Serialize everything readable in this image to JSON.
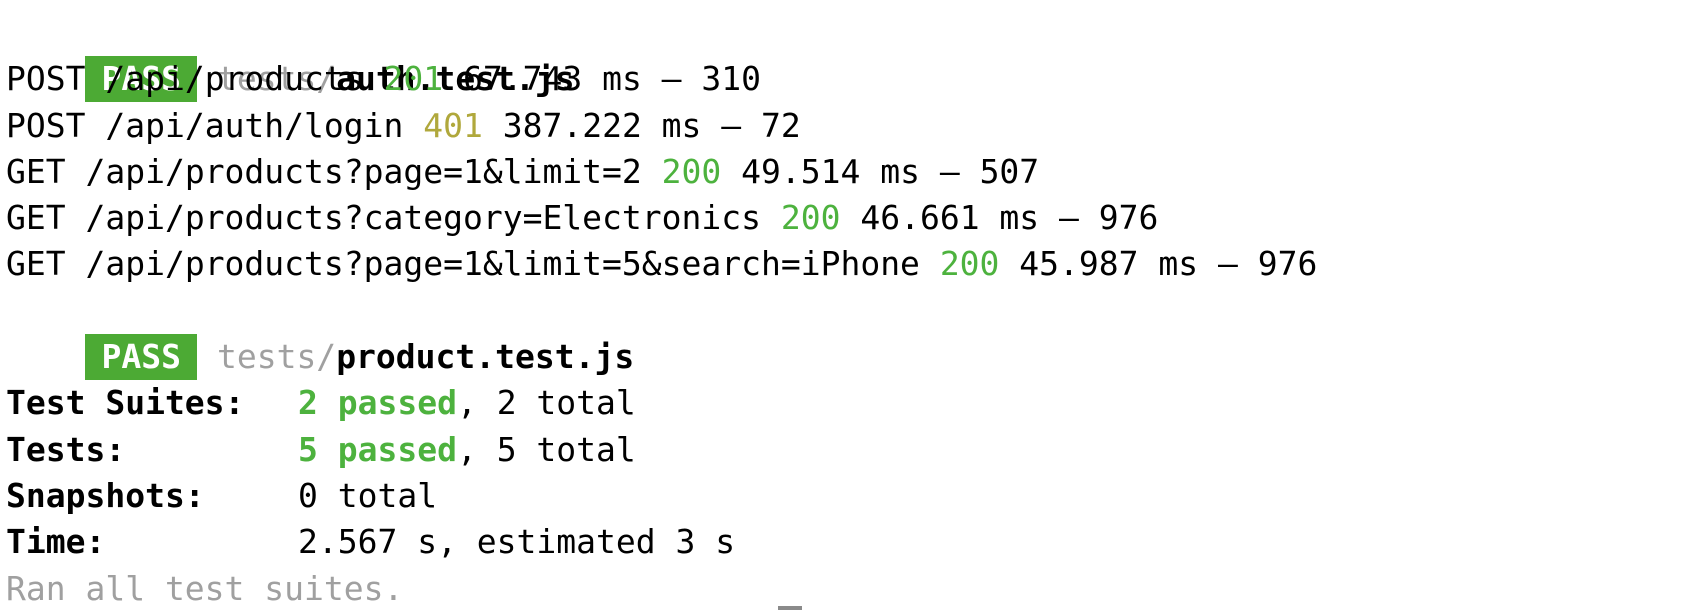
{
  "suites": [
    {
      "badge": "PASS",
      "dir": "tests/",
      "file": "auth.test.js"
    },
    {
      "badge": "PASS",
      "dir": "tests/",
      "file": "product.test.js"
    }
  ],
  "requests": [
    {
      "method": "POST",
      "path": "/api/products",
      "status": "201",
      "status_color": "#4db23e",
      "time": "67.743 ms",
      "size": "310"
    },
    {
      "method": "POST",
      "path": "/api/auth/login",
      "status": "401",
      "status_color": "#b0a83c",
      "time": "387.222 ms",
      "size": "72"
    },
    {
      "method": "GET",
      "path": "/api/products?page=1&limit=2",
      "status": "200",
      "status_color": "#4db23e",
      "time": "49.514 ms",
      "size": "507"
    },
    {
      "method": "GET",
      "path": "/api/products?category=Electronics",
      "status": "200",
      "status_color": "#4db23e",
      "time": "46.661 ms",
      "size": "976"
    },
    {
      "method": "GET",
      "path": "/api/products?page=1&limit=5&search=iPhone",
      "status": "200",
      "status_color": "#4db23e",
      "time": "45.987 ms",
      "size": "976"
    }
  ],
  "summary": {
    "suites_label": "Test Suites:",
    "suites_passed": "2 passed",
    "suites_total": ", 2 total",
    "tests_label": "Tests:",
    "tests_passed": "5 passed",
    "tests_total": ", 5 total",
    "snapshots_label": "Snapshots:",
    "snapshots_value": "0 total",
    "time_label": "Time:",
    "time_value": "2.567 s, estimated 3 s",
    "footer": "Ran all test suites."
  },
  "colors": {
    "pass_badge": "#4caa34",
    "success": "#4db23e",
    "warning": "#b0a83c",
    "dim": "#a0a0a0"
  },
  "separator": " – "
}
